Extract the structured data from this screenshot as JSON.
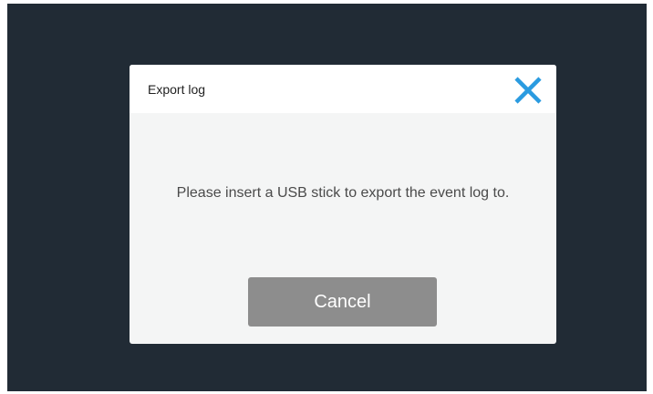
{
  "dialog": {
    "title": "Export log",
    "close_icon": "close-icon",
    "message": "Please insert a USB stick to export the event log to.",
    "cancel_label": "Cancel"
  },
  "colors": {
    "background": "#212b35",
    "dialog_body": "#f4f5f5",
    "dialog_header": "#ffffff",
    "close_icon": "#2a9be0",
    "cancel_button": "#8d8d8d"
  }
}
